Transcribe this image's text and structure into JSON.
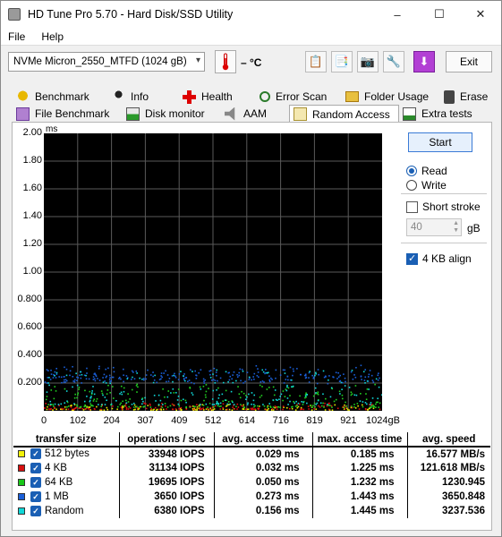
{
  "window": {
    "title": "HD Tune Pro 5.70 - Hard Disk/SSD Utility",
    "min": "–",
    "max": "☐",
    "close": "✕"
  },
  "menu": {
    "file": "File",
    "help": "Help"
  },
  "toolbar": {
    "drive": "NVMe     Micron_2550_MTFD (1024 gB)",
    "temperature": "– °C",
    "exit": "Exit"
  },
  "tabs_row1": [
    "Benchmark",
    "Info",
    "Health",
    "Error Scan",
    "Folder Usage",
    "Erase"
  ],
  "tabs_row2": [
    "File Benchmark",
    "Disk monitor",
    "AAM",
    "Random Access",
    "Extra tests"
  ],
  "active_tab": "Random Access",
  "controls": {
    "start": "Start",
    "read": "Read",
    "write": "Write",
    "short_stroke": "Short stroke",
    "short_stroke_value": "40",
    "gb": "gB",
    "align": "4 KB align",
    "read_selected": true,
    "align_checked": true,
    "short_stroke_checked": false
  },
  "chart_data": {
    "type": "scatter",
    "ylabel": "ms",
    "ylim": [
      0,
      2.0
    ],
    "xlim": [
      0,
      1024
    ],
    "y_ticks": [
      "2.00",
      "1.80",
      "1.60",
      "1.40",
      "1.20",
      "1.00",
      "0.800",
      "0.600",
      "0.400",
      "0.200"
    ],
    "x_ticks": [
      "0",
      "102",
      "204",
      "307",
      "409",
      "512",
      "614",
      "716",
      "819",
      "921",
      "1024gB"
    ],
    "series": [
      {
        "name": "512 bytes",
        "color": "#e8e800",
        "band": [
          0.01,
          0.05
        ]
      },
      {
        "name": "4 KB",
        "color": "#e01010",
        "band": [
          0.015,
          0.06
        ]
      },
      {
        "name": "64 KB",
        "color": "#20d020",
        "band": [
          0.03,
          0.2
        ]
      },
      {
        "name": "1 MB",
        "color": "#1a5fd8",
        "band": [
          0.2,
          0.34
        ]
      },
      {
        "name": "Random",
        "color": "#10d8d8",
        "band": [
          0.05,
          0.3
        ]
      }
    ]
  },
  "table": {
    "headers": [
      "transfer size",
      "operations / sec",
      "avg. access time",
      "max. access time",
      "avg. speed"
    ],
    "rows": [
      {
        "color": "#f2f20a",
        "size": "512 bytes",
        "ops": "33948",
        "iops": "IOPS",
        "avg": "0.029 ms",
        "max": "0.185 ms",
        "speed": "16.577 MB/s"
      },
      {
        "color": "#d81010",
        "size": "4 KB",
        "ops": "31134",
        "iops": "IOPS",
        "avg": "0.032 ms",
        "max": "1.225 ms",
        "speed": "121.618 MB/s"
      },
      {
        "color": "#18c818",
        "size": "64 KB",
        "ops": "19695",
        "iops": "IOPS",
        "avg": "0.050 ms",
        "max": "1.232 ms",
        "speed": "1230.945"
      },
      {
        "color": "#1a5fd8",
        "size": "1 MB",
        "ops": "3650",
        "iops": "IOPS",
        "avg": "0.273 ms",
        "max": "1.443 ms",
        "speed": "3650.848"
      },
      {
        "color": "#10d8d8",
        "size": "Random",
        "ops": "6380",
        "iops": "IOPS",
        "avg": "0.156 ms",
        "max": "1.445 ms",
        "speed": "3237.536"
      }
    ]
  }
}
